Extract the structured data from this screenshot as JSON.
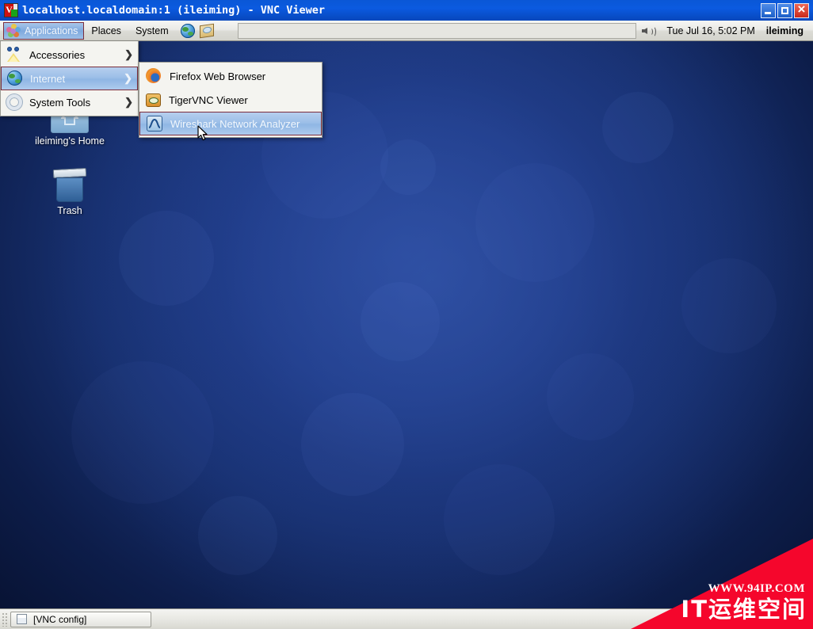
{
  "window": {
    "title": "localhost.localdomain:1 (ileiming) - VNC Viewer",
    "icon": "vnc-logo-icon",
    "controls": {
      "minimize": "minimize-button",
      "maximize": "maximize-button",
      "close": "close-button"
    }
  },
  "top_panel": {
    "applications": {
      "label": "Applications",
      "icon": "applications-flower-icon"
    },
    "places": {
      "label": "Places"
    },
    "system": {
      "label": "System"
    },
    "launchers": [
      {
        "name": "web-browser-launcher",
        "icon": "globe-icon"
      },
      {
        "name": "mail-reader-launcher",
        "icon": "mail-icon"
      }
    ],
    "tray": {
      "volume_icon": "speaker-icon",
      "clock": "Tue Jul 16,  5:02 PM",
      "user": "ileiming"
    }
  },
  "applications_menu": {
    "items": [
      {
        "label": "Accessories",
        "icon": "accessories-icon",
        "has_submenu": true,
        "selected": false,
        "arrow": "❯"
      },
      {
        "label": "Internet",
        "icon": "globe-icon",
        "has_submenu": true,
        "selected": true,
        "arrow": "❯"
      },
      {
        "label": "System Tools",
        "icon": "gear-icon",
        "has_submenu": true,
        "selected": false,
        "arrow": "❯"
      }
    ]
  },
  "internet_submenu": {
    "items": [
      {
        "label": "Firefox Web Browser",
        "icon": "firefox-icon",
        "selected": false
      },
      {
        "label": "TigerVNC Viewer",
        "icon": "tigervnc-icon",
        "selected": false
      },
      {
        "label": "Wireshark Network Analyzer",
        "icon": "wireshark-icon",
        "selected": true
      }
    ]
  },
  "desktop_icons": [
    {
      "label": "ileiming's Home",
      "icon": "home-folder-icon"
    },
    {
      "label": "Trash",
      "icon": "trash-icon"
    }
  ],
  "bottom_panel": {
    "tasks": [
      {
        "label": "[VNC config]",
        "icon": "window-icon"
      }
    ]
  },
  "watermark": {
    "url": "WWW.94IP.COM",
    "text": "IT运维空间",
    "color": "#f5062c"
  },
  "colors": {
    "titlebar_blue": "#0b5ae0",
    "desktop_blue": "#213f8d",
    "menu_highlight": "#9dbfe8",
    "menu_highlight_border": "#7b2d3c",
    "panel_gray": "#e8e8e3"
  }
}
